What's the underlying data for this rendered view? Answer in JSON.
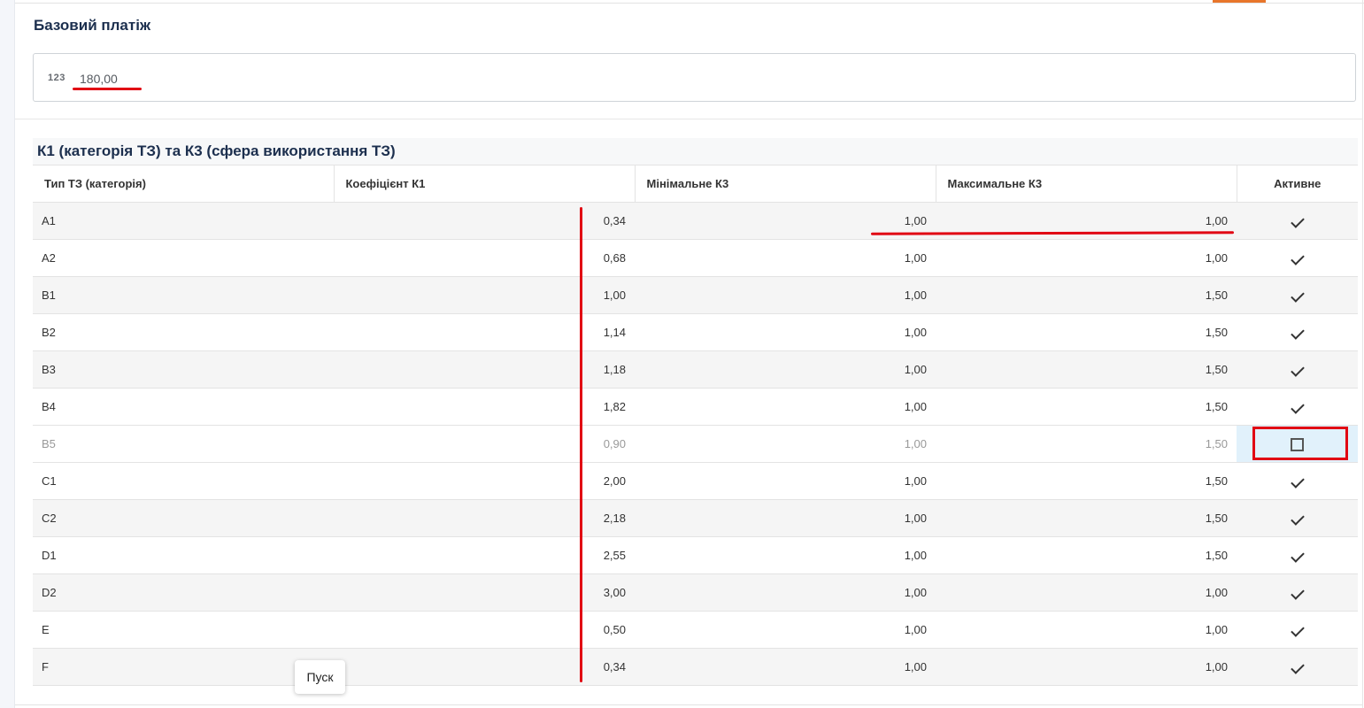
{
  "base_payment": {
    "title": "Базовий платіж",
    "type_badge": "123",
    "value": "180,00"
  },
  "table": {
    "title": "К1 (категорія ТЗ) та К3 (сфера використання ТЗ)",
    "columns": [
      "Тип ТЗ (категорія)",
      "Коефіцієнт К1",
      "Мінімальне К3",
      "Максимальне К3",
      "Активне"
    ],
    "rows": [
      {
        "type": "A1",
        "k1": "0,34",
        "min_k3": "1,00",
        "max_k3": "1,00",
        "active": true
      },
      {
        "type": "A2",
        "k1": "0,68",
        "min_k3": "1,00",
        "max_k3": "1,00",
        "active": true
      },
      {
        "type": "B1",
        "k1": "1,00",
        "min_k3": "1,00",
        "max_k3": "1,50",
        "active": true
      },
      {
        "type": "B2",
        "k1": "1,14",
        "min_k3": "1,00",
        "max_k3": "1,50",
        "active": true
      },
      {
        "type": "B3",
        "k1": "1,18",
        "min_k3": "1,00",
        "max_k3": "1,50",
        "active": true
      },
      {
        "type": "B4",
        "k1": "1,82",
        "min_k3": "1,00",
        "max_k3": "1,50",
        "active": true
      },
      {
        "type": "B5",
        "k1": "0,90",
        "min_k3": "1,00",
        "max_k3": "1,50",
        "active": false
      },
      {
        "type": "C1",
        "k1": "2,00",
        "min_k3": "1,00",
        "max_k3": "1,50",
        "active": true
      },
      {
        "type": "C2",
        "k1": "2,18",
        "min_k3": "1,00",
        "max_k3": "1,50",
        "active": true
      },
      {
        "type": "D1",
        "k1": "2,55",
        "min_k3": "1,00",
        "max_k3": "1,50",
        "active": true
      },
      {
        "type": "D2",
        "k1": "3,00",
        "min_k3": "1,00",
        "max_k3": "1,00",
        "active": true
      },
      {
        "type": "E",
        "k1": "0,50",
        "min_k3": "1,00",
        "max_k3": "1,00",
        "active": true
      },
      {
        "type": "F",
        "k1": "0,34",
        "min_k3": "1,00",
        "max_k3": "1,00",
        "active": true
      }
    ]
  },
  "tooltip": {
    "text": "Пуск"
  },
  "colors": {
    "accent_orange": "#e8762b",
    "annotation_red": "#e10613",
    "title_navy": "#1c2f4e",
    "inactive_highlight": "#e1f1fb"
  }
}
